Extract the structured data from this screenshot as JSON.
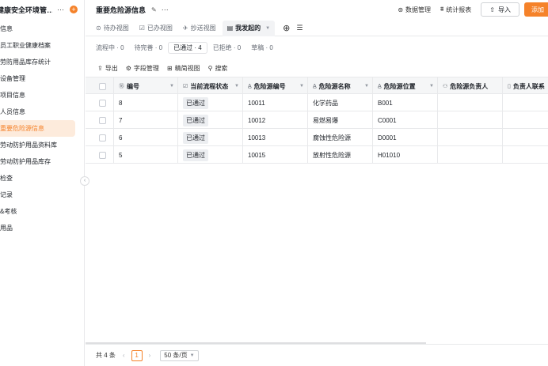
{
  "sidebar": {
    "title": "健康安全环境管…",
    "items": [
      {
        "label": "信息",
        "active": false
      },
      {
        "label": "员工职业健康档案",
        "active": false
      },
      {
        "label": "劳防用品库存统计",
        "active": false
      },
      {
        "label": "设备管理",
        "active": false
      },
      {
        "label": "项目信息",
        "active": false
      },
      {
        "label": "人员信息",
        "active": false
      },
      {
        "label": "重要危险源信息",
        "active": true
      },
      {
        "label": "劳动防护用品资料库",
        "active": false
      },
      {
        "label": "劳动防护用品库存",
        "active": false
      },
      {
        "label": "检查",
        "active": false
      },
      {
        "label": "记录",
        "active": false
      },
      {
        "label": "&考核",
        "active": false
      },
      {
        "label": "用品",
        "active": false
      }
    ]
  },
  "header": {
    "title": "重要危险源信息",
    "data_manage": "数据管理",
    "stats_report": "统计报表",
    "import": "导入",
    "add": "添加"
  },
  "view_tabs": [
    {
      "label": "待办视图",
      "icon": "todo-icon"
    },
    {
      "label": "已办视图",
      "icon": "done-icon"
    },
    {
      "label": "抄送视图",
      "icon": "cc-icon"
    },
    {
      "label": "我发起的",
      "icon": "initiated-icon"
    }
  ],
  "status_tabs": [
    {
      "label": "流程中 · 0"
    },
    {
      "label": "待完善 · 0"
    },
    {
      "label": "已通过 · 4"
    },
    {
      "label": "已拒绝 · 0"
    },
    {
      "label": "草稿 · 0"
    }
  ],
  "toolbar": {
    "export": "导出",
    "field_manage": "字段管理",
    "simple_view": "精简视图",
    "search": "搜索"
  },
  "table": {
    "columns": [
      "编号",
      "当前流程状态",
      "危险源编号",
      "危险源名称",
      "危险源位置",
      "危险源负责人",
      "负责人联系"
    ],
    "rows": [
      {
        "no": "8",
        "state": "已通过",
        "code": "10011",
        "name": "化学药品",
        "loc": "B001",
        "owner": "",
        "phone": ""
      },
      {
        "no": "7",
        "state": "已通过",
        "code": "10012",
        "name": "易燃易爆",
        "loc": "C0001",
        "owner": "",
        "phone": ""
      },
      {
        "no": "6",
        "state": "已通过",
        "code": "10013",
        "name": "腐蚀性危险源",
        "loc": "D0001",
        "owner": "",
        "phone": ""
      },
      {
        "no": "5",
        "state": "已通过",
        "code": "10015",
        "name": "放射性危险源",
        "loc": "H01010",
        "owner": "",
        "phone": ""
      }
    ]
  },
  "footer": {
    "total": "共 4 条",
    "page": "1",
    "page_size": "50 条/页"
  }
}
